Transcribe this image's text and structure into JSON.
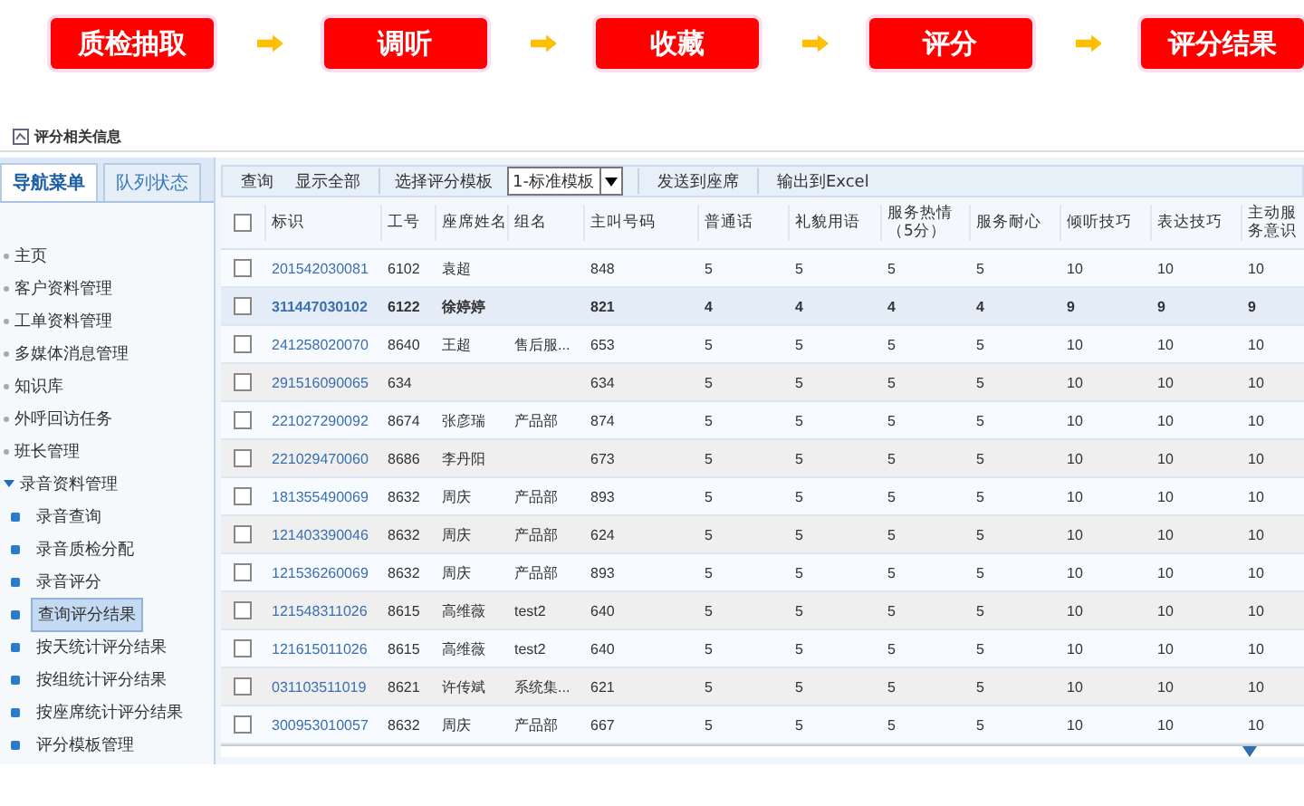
{
  "flow_steps": [
    {
      "label": "质检抽取"
    },
    {
      "label": "调听"
    },
    {
      "label": "收藏"
    },
    {
      "label": "评分"
    },
    {
      "label": "评分结果"
    }
  ],
  "window": {
    "title": "评分相关信息"
  },
  "sidebar": {
    "tabs": [
      {
        "label": "导航菜单",
        "selected": true
      },
      {
        "label": "队列状态",
        "selected": false
      }
    ],
    "items": [
      {
        "label": "主页"
      },
      {
        "label": "客户资料管理"
      },
      {
        "label": "工单资料管理"
      },
      {
        "label": "多媒体消息管理"
      },
      {
        "label": "知识库"
      },
      {
        "label": "外呼回访任务"
      },
      {
        "label": "班长管理"
      },
      {
        "label": "录音资料管理",
        "expanded": true,
        "children": [
          {
            "label": "录音查询",
            "selected": false
          },
          {
            "label": "录音质检分配",
            "selected": false
          },
          {
            "label": "录音评分",
            "selected": false
          },
          {
            "label": "查询评分结果",
            "selected": true
          },
          {
            "label": "按天统计评分结果",
            "selected": false
          },
          {
            "label": "按组统计评分结果",
            "selected": false
          },
          {
            "label": "按座席统计评分结果",
            "selected": false
          },
          {
            "label": "评分模板管理",
            "selected": false
          }
        ]
      }
    ]
  },
  "toolbar": {
    "buttons": [
      {
        "label": "查询"
      },
      {
        "label": "显示全部"
      }
    ],
    "template_label": "选择评分模板",
    "template_value": "1-标准模板",
    "actions": [
      {
        "label": "发送到座席"
      },
      {
        "label": "输出到Excel"
      }
    ]
  },
  "table": {
    "all_checked": false,
    "columns": [
      "标识",
      "工号",
      "座席姓名",
      "组名",
      "主叫号码",
      "普通话",
      "礼貌用语",
      "服务热情（5分）",
      "服务耐心",
      "倾听技巧",
      "表达技巧",
      "主动服务意识"
    ],
    "rows": [
      {
        "selected": false,
        "checked": false,
        "cells": [
          "201542030081",
          "6102",
          "袁超",
          "",
          "848",
          "5",
          "5",
          "5",
          "5",
          "10",
          "10",
          "10"
        ]
      },
      {
        "selected": true,
        "checked": false,
        "cells": [
          "311447030102",
          "6122",
          "徐婷婷",
          "",
          "821",
          "4",
          "4",
          "4",
          "4",
          "9",
          "9",
          "9"
        ]
      },
      {
        "selected": false,
        "checked": false,
        "cells": [
          "241258020070",
          "8640",
          "王超",
          "售后服...",
          "653",
          "5",
          "5",
          "5",
          "5",
          "10",
          "10",
          "10"
        ]
      },
      {
        "selected": false,
        "checked": false,
        "cells": [
          "291516090065",
          "634",
          "",
          "",
          "634",
          "5",
          "5",
          "5",
          "5",
          "10",
          "10",
          "10"
        ]
      },
      {
        "selected": false,
        "checked": false,
        "cells": [
          "221027290092",
          "8674",
          "张彦瑞",
          "产品部",
          "874",
          "5",
          "5",
          "5",
          "5",
          "10",
          "10",
          "10"
        ]
      },
      {
        "selected": false,
        "checked": false,
        "cells": [
          "221029470060",
          "8686",
          "李丹阳",
          "",
          "673",
          "5",
          "5",
          "5",
          "5",
          "10",
          "10",
          "10"
        ]
      },
      {
        "selected": false,
        "checked": false,
        "cells": [
          "181355490069",
          "8632",
          "周庆",
          "产品部",
          "893",
          "5",
          "5",
          "5",
          "5",
          "10",
          "10",
          "10"
        ]
      },
      {
        "selected": false,
        "checked": false,
        "cells": [
          "121403390046",
          "8632",
          "周庆",
          "产品部",
          "624",
          "5",
          "5",
          "5",
          "5",
          "10",
          "10",
          "10"
        ]
      },
      {
        "selected": false,
        "checked": false,
        "cells": [
          "121536260069",
          "8632",
          "周庆",
          "产品部",
          "893",
          "5",
          "5",
          "5",
          "5",
          "10",
          "10",
          "10"
        ]
      },
      {
        "selected": false,
        "checked": false,
        "cells": [
          "121548311026",
          "8615",
          "高维薇",
          "test2",
          "640",
          "5",
          "5",
          "5",
          "5",
          "10",
          "10",
          "10"
        ]
      },
      {
        "selected": false,
        "checked": false,
        "cells": [
          "121615011026",
          "8615",
          "高维薇",
          "test2",
          "640",
          "5",
          "5",
          "5",
          "5",
          "10",
          "10",
          "10"
        ]
      },
      {
        "selected": false,
        "checked": false,
        "cells": [
          "031103511019",
          "8621",
          "许传斌",
          "系统集...",
          "621",
          "5",
          "5",
          "5",
          "5",
          "10",
          "10",
          "10"
        ]
      },
      {
        "selected": false,
        "checked": false,
        "cells": [
          "300953010057",
          "8632",
          "周庆",
          "产品部",
          "667",
          "5",
          "5",
          "5",
          "5",
          "10",
          "10",
          "10"
        ]
      }
    ]
  }
}
